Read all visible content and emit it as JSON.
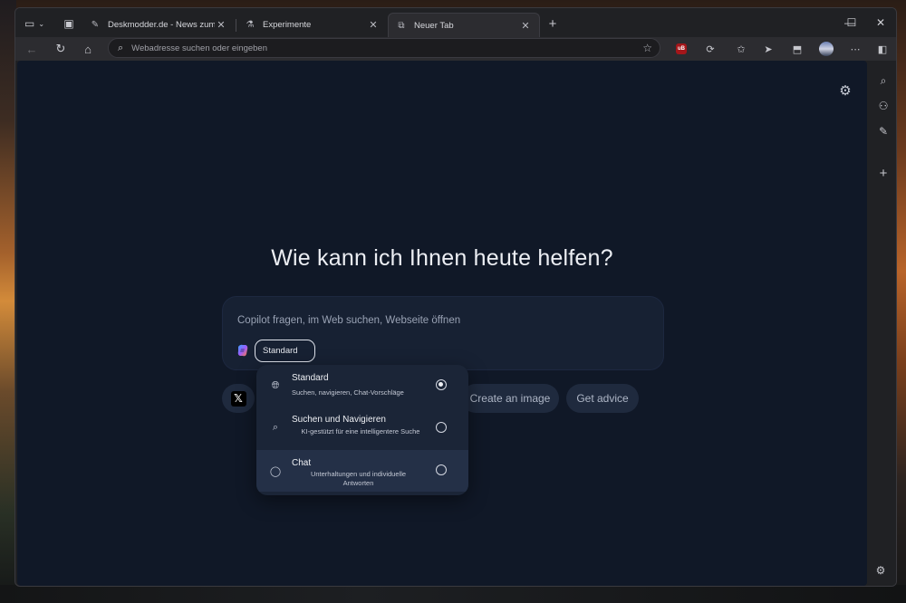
{
  "tabs": [
    {
      "title": "Deskmodder.de - News zum The",
      "icon": "pen-icon"
    },
    {
      "title": "Experimente",
      "icon": "flask-icon"
    },
    {
      "title": "Neuer Tab",
      "icon": "newtab-icon",
      "active": true
    }
  ],
  "address_bar": {
    "placeholder": "Webadresse suchen oder eingeben"
  },
  "extensions": {
    "ublock_label": "uB"
  },
  "page": {
    "heading": "Wie kann ich Ihnen heute helfen?",
    "compose_placeholder": "Copilot fragen, im Web suchen, Webseite öffnen",
    "mode_selected": "Standard",
    "chips": [
      {
        "label": "Create an image"
      },
      {
        "label": "Get advice"
      }
    ],
    "x_chip_glyph": "𝕏"
  },
  "mode_menu": [
    {
      "title": "Standard",
      "desc": "Suchen, navigieren, Chat-Vorschläge",
      "icon": "globe-icon",
      "selected": true
    },
    {
      "title": "Suchen und Navigieren",
      "desc": "KI-gestützt für eine intelligentere Suche",
      "icon": "search-icon",
      "selected": false
    },
    {
      "title": "Chat",
      "desc": "Unterhaltungen und individuelle Antworten",
      "icon": "chat-bubble-icon",
      "selected": false
    }
  ],
  "colors": {
    "page_bg": "#101827",
    "compose_bg": "#172133",
    "accent": "#eef0f4"
  }
}
